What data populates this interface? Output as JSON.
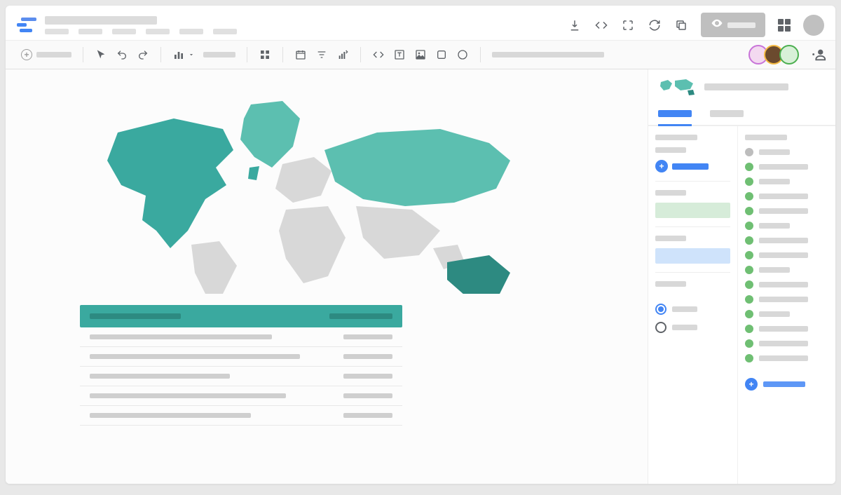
{
  "header": {
    "title": "",
    "menu_items": [
      "",
      "",
      "",
      "",
      "",
      ""
    ],
    "actions": {
      "download_label": "",
      "embed_label": "",
      "fullscreen_label": "",
      "refresh_label": "",
      "copy_label": "",
      "view_label": "",
      "apps_label": ""
    }
  },
  "toolbar": {
    "add_page_label": "",
    "chart_label": "",
    "theme_label": ""
  },
  "map": {
    "regions": [
      {
        "name": "North America",
        "color": "#3aa99f"
      },
      {
        "name": "Greenland",
        "color": "#5cbfb0"
      },
      {
        "name": "South America",
        "color": "#d8d8d8"
      },
      {
        "name": "Europe",
        "color": "#d8d8d8"
      },
      {
        "name": "Africa",
        "color": "#d8d8d8"
      },
      {
        "name": "Russia/North Asia",
        "color": "#5cbfb0"
      },
      {
        "name": "South/East Asia",
        "color": "#d8d8d8"
      },
      {
        "name": "Australia",
        "color": "#2d8a81"
      }
    ]
  },
  "table": {
    "header": {
      "col1": "",
      "col2": ""
    },
    "rows": [
      {
        "c1_width": 260,
        "c2_width": 70
      },
      {
        "c1_width": 300,
        "c2_width": 70
      },
      {
        "c1_width": 200,
        "c2_width": 70
      },
      {
        "c1_width": 280,
        "c2_width": 70
      },
      {
        "c1_width": 230,
        "c2_width": 70
      }
    ]
  },
  "panel": {
    "title": "",
    "tabs": [
      {
        "label": "",
        "active": true
      },
      {
        "label": "",
        "active": false
      }
    ],
    "left": {
      "section1_label": "",
      "dimension_chip": "",
      "section2_label": "",
      "section3_label": "",
      "section4_label": "",
      "radio_options": [
        {
          "label": "",
          "checked": true
        },
        {
          "label": "",
          "checked": false
        }
      ]
    },
    "right": {
      "header_label": "",
      "fields": [
        {
          "dot": "gray",
          "w": "short"
        },
        {
          "dot": "green",
          "w": "long"
        },
        {
          "dot": "green",
          "w": "short"
        },
        {
          "dot": "green",
          "w": "long"
        },
        {
          "dot": "green",
          "w": "long"
        },
        {
          "dot": "green",
          "w": "short"
        },
        {
          "dot": "green",
          "w": "long"
        },
        {
          "dot": "green",
          "w": "long"
        },
        {
          "dot": "green",
          "w": "short"
        },
        {
          "dot": "green",
          "w": "long"
        },
        {
          "dot": "green",
          "w": "long"
        },
        {
          "dot": "green",
          "w": "short"
        },
        {
          "dot": "green",
          "w": "long"
        },
        {
          "dot": "green",
          "w": "long"
        },
        {
          "dot": "green",
          "w": "long"
        }
      ],
      "add_label": ""
    }
  },
  "collaborators": [
    {
      "id": 1
    },
    {
      "id": 2
    },
    {
      "id": 3
    }
  ]
}
